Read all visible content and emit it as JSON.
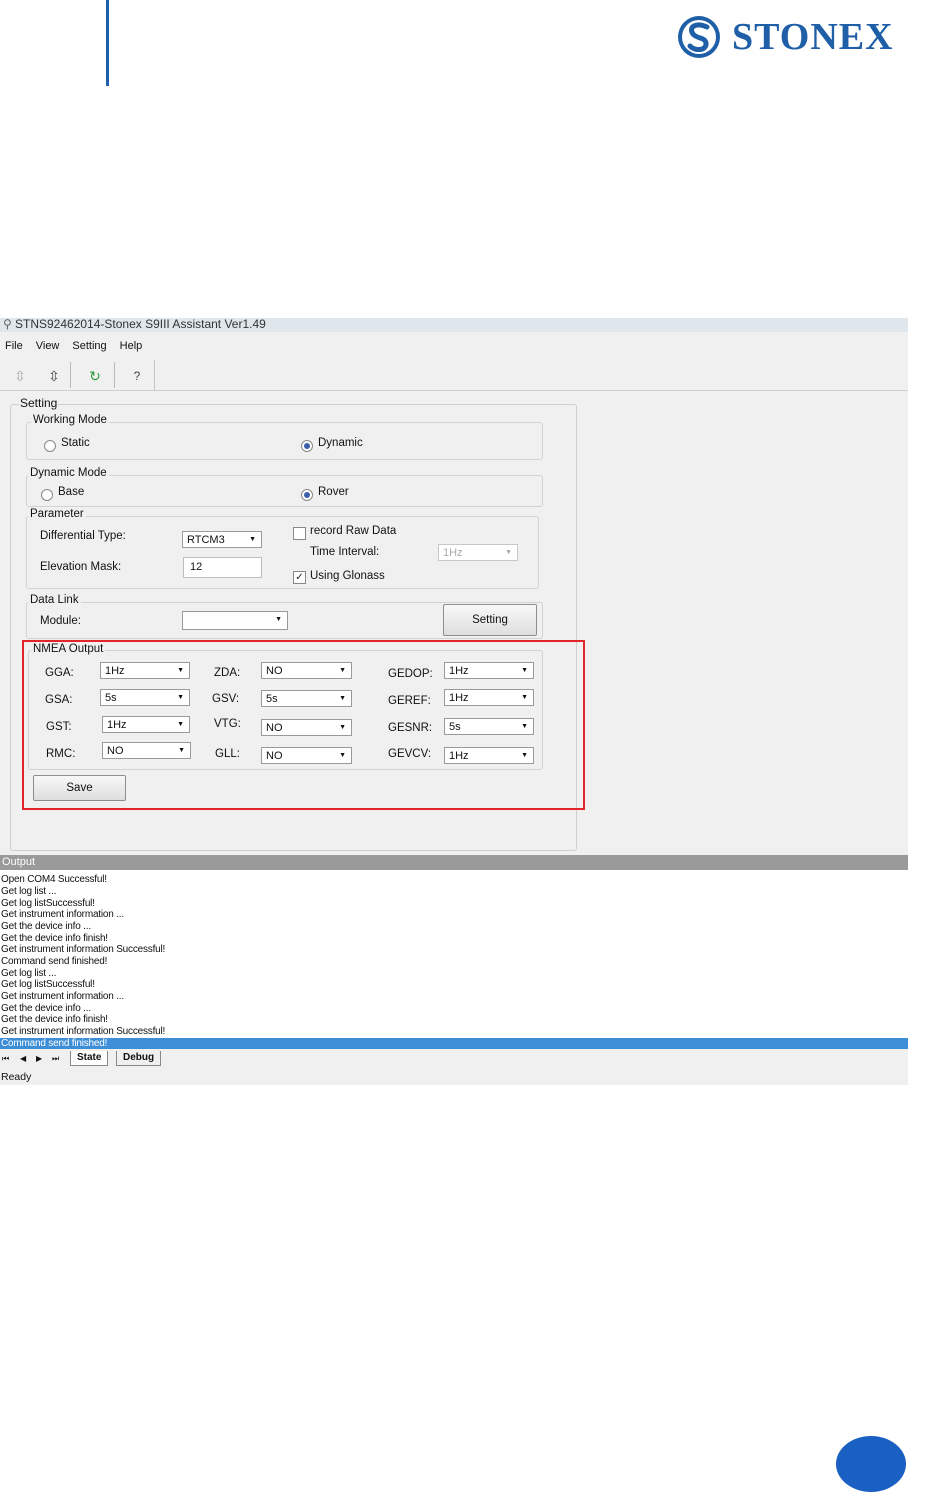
{
  "page": {
    "brand": "STONEX",
    "colors": {
      "brand_blue": "#1f5fa8",
      "highlight_box": "#e2242b",
      "selected_log": "#3d8ed6"
    }
  },
  "app": {
    "title": "STNS92462014-Stonex S9III Assistant Ver1.49",
    "menu": [
      "File",
      "View",
      "Setting",
      "Help"
    ],
    "toolbar_icons": [
      "connect-icon",
      "disconnect-icon",
      "refresh-icon",
      "help-icon"
    ]
  },
  "setting": {
    "title": "Setting",
    "working_mode": {
      "title": "Working Mode",
      "options": [
        "Static",
        "Dynamic"
      ],
      "selected": "Dynamic"
    },
    "dynamic_mode": {
      "title": "Dynamic Mode",
      "options": [
        "Base",
        "Rover"
      ],
      "selected": "Rover"
    },
    "parameter": {
      "title": "Parameter",
      "differential_type_label": "Differential Type:",
      "differential_type": "RTCM3",
      "elevation_mask_label": "Elevation Mask:",
      "elevation_mask": "12",
      "record_raw_label": "record Raw Data",
      "record_raw_checked": false,
      "time_interval_label": "Time Interval:",
      "time_interval": "1Hz",
      "glonass_label": "Using Glonass",
      "glonass_checked": true
    },
    "data_link": {
      "title": "Data Link",
      "module_label": "Module:",
      "module": "",
      "setting_button": "Setting"
    },
    "nmea": {
      "title": "NMEA Output",
      "rows": [
        [
          {
            "label": "GGA:",
            "value": "1Hz"
          },
          {
            "label": "ZDA:",
            "value": "NO"
          },
          {
            "label": "GEDOP:",
            "value": "1Hz"
          }
        ],
        [
          {
            "label": "GSA:",
            "value": "5s"
          },
          {
            "label": "GSV:",
            "value": "5s"
          },
          {
            "label": "GEREF:",
            "value": "1Hz"
          }
        ],
        [
          {
            "label": "GST:",
            "value": "1Hz"
          },
          {
            "label": "VTG:",
            "value": "NO"
          },
          {
            "label": "GESNR:",
            "value": "5s"
          }
        ],
        [
          {
            "label": "RMC:",
            "value": "NO"
          },
          {
            "label": "GLL:",
            "value": "NO"
          },
          {
            "label": "GEVCV:",
            "value": "1Hz"
          }
        ]
      ],
      "save_button": "Save"
    }
  },
  "output": {
    "title": "Output",
    "lines": [
      "Open COM4 Successful!",
      "Get  log list ...",
      "Get  log listSuccessful!",
      "Get instrument information ...",
      "Get the device info ...",
      "Get the device info finish!",
      "Get instrument information Successful!",
      "Command send finished!",
      "Get  log list ...",
      "Get  log listSuccessful!",
      "Get instrument information ...",
      "Get the device info ...",
      "Get the device info finish!",
      "Get instrument information Successful!",
      "Command send finished!"
    ],
    "selected_line": 14,
    "tabs": [
      "State",
      "Debug"
    ],
    "active_tab": "State"
  },
  "status": "Ready"
}
